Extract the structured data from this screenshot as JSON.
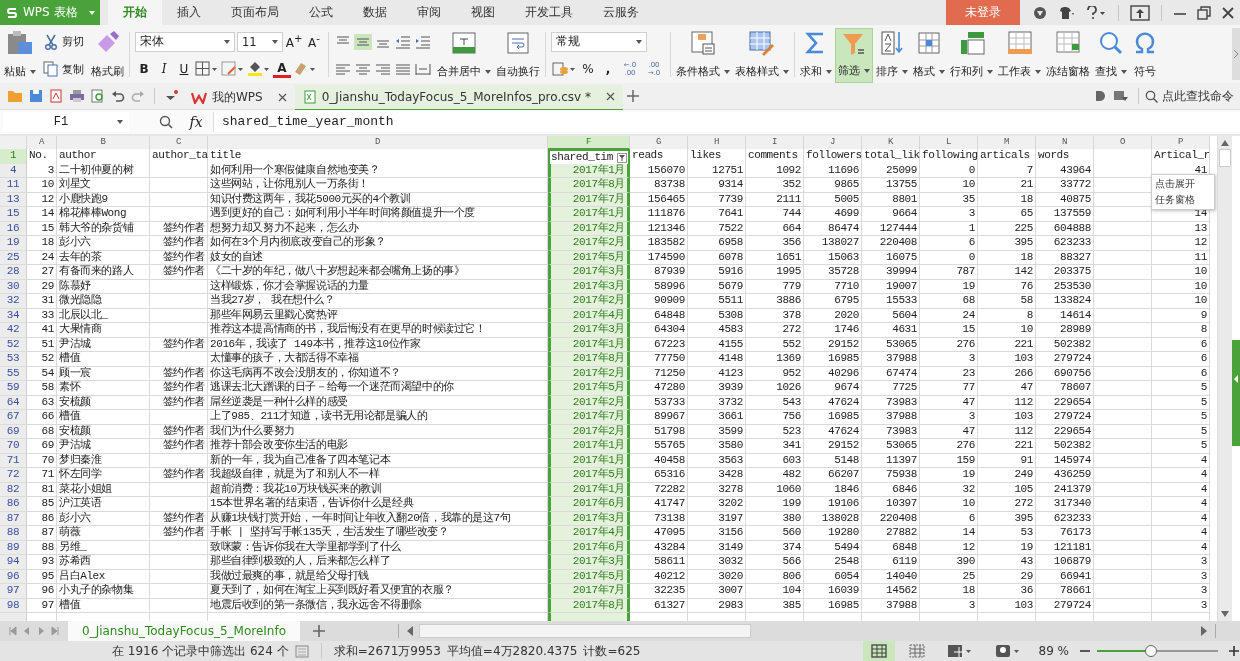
{
  "app_menu": {
    "label": "WPS 表格"
  },
  "tabs": [
    {
      "label": "开始",
      "selected": true
    },
    {
      "label": "插入",
      "selected": false
    },
    {
      "label": "页面布局",
      "selected": false
    },
    {
      "label": "公式",
      "selected": false
    },
    {
      "label": "数据",
      "selected": false
    },
    {
      "label": "审阅",
      "selected": false
    },
    {
      "label": "视图",
      "selected": false
    },
    {
      "label": "开发工具",
      "selected": false
    },
    {
      "label": "云服务",
      "selected": false
    }
  ],
  "login": {
    "label": "未登录"
  },
  "ribbon": {
    "paste": "粘贴",
    "cut": "剪切",
    "copy": "复制",
    "painter": "格式刷",
    "font": "宋体",
    "font_size": "11",
    "grow_font": "A$^{+}$",
    "shrink_font": "A$^{-}$",
    "bold": "B",
    "italic": "I",
    "underline": "U",
    "font_color": "A",
    "merge": "合并居中",
    "wrap": "自动换行",
    "number_format": "常规",
    "percent": "%",
    "comma": ",",
    "increase_decimal": [
      "←.0",
      ".00"
    ],
    "decrease_decimal": [
      ".00",
      "→.0"
    ],
    "conditional": "条件格式",
    "table_style": "表格样式",
    "sum": "求和",
    "filter": {
      "label": "筛选",
      "on": true
    },
    "sort": "排序",
    "format": "格式",
    "rows_cols": "行和列",
    "sheet": "工作表",
    "freeze": "冻结窗格",
    "find": "查找",
    "symbol": "符号"
  },
  "doc_tabs": [
    {
      "label": "我的WPS",
      "selected": false
    },
    {
      "label": "0_Jianshu_TodayFocus_5_MoreInfos_pro.csv *",
      "selected": true
    }
  ],
  "command_search": {
    "placeholder": "点此查找命令"
  },
  "name_box": "F1",
  "fx": "fx",
  "formula": "shared_time_year_month",
  "columns": [
    {
      "letter": "A",
      "selected": false
    },
    {
      "letter": "B",
      "selected": false
    },
    {
      "letter": "C",
      "selected": false
    },
    {
      "letter": "D",
      "selected": false
    },
    {
      "letter": "F",
      "selected": true
    },
    {
      "letter": "G",
      "selected": false
    },
    {
      "letter": "H",
      "selected": false
    },
    {
      "letter": "I",
      "selected": false
    },
    {
      "letter": "J",
      "selected": false
    },
    {
      "letter": "K",
      "selected": false
    },
    {
      "letter": "L",
      "selected": false
    },
    {
      "letter": "M",
      "selected": false
    },
    {
      "letter": "N",
      "selected": false
    },
    {
      "letter": "O",
      "selected": false
    },
    {
      "letter": "P",
      "selected": false
    }
  ],
  "header_row": {
    "n": "1",
    "no": "No.",
    "author": "author",
    "tag": "author_ta",
    "title": "title",
    "month": "shared_tim",
    "reads": "reads",
    "likes": "likes",
    "comments": "comments",
    "followers": "followers",
    "total_likes": "total_lik",
    "following": "following",
    "articals": "articals",
    "words": "words",
    "col_p": "Artical_r"
  },
  "rows": [
    {
      "n": "4",
      "no": "3",
      "author": "二十初仲夏的树",
      "title": "如何利用一个寒假健康自然地变美？",
      "month": "2017年1月",
      "reads": "156070",
      "likes": "12751",
      "comments": "1092",
      "followers": "11696",
      "total_likes": "25099",
      "following": "0",
      "articals": "7",
      "words": "43964",
      "col_p": "41"
    },
    {
      "n": "11",
      "no": "10",
      "author": "刘星文",
      "title": "这些网站，让你甩别人一万条街！",
      "month": "2017年8月",
      "reads": "83738",
      "likes": "9314",
      "comments": "352",
      "followers": "9865",
      "total_likes": "13755",
      "following": "10",
      "articals": "21",
      "words": "33772"
    },
    {
      "n": "13",
      "no": "12",
      "author": "小鹿快跑9",
      "title": "知识付费这两年，我花5000元买的4个教训",
      "month": "2017年7月",
      "reads": "156465",
      "likes": "7739",
      "comments": "2111",
      "followers": "5005",
      "total_likes": "8801",
      "following": "35",
      "articals": "18",
      "words": "40875"
    },
    {
      "n": "15",
      "no": "14",
      "author": "棉花棒棒Wong",
      "title": "遇到更好的自己：如何利用小半年时间将颜值提升一个度",
      "month": "2017年1月",
      "reads": "111876",
      "likes": "7641",
      "comments": "744",
      "followers": "4699",
      "total_likes": "9664",
      "following": "3",
      "articals": "65",
      "words": "137559",
      "col_p": "14"
    },
    {
      "n": "16",
      "no": "15",
      "author": "韩大爷的杂货铺",
      "tag": "签约作者",
      "title": "想努力却又努力不起来，怎么办",
      "month": "2017年2月",
      "reads": "121346",
      "likes": "7522",
      "comments": "664",
      "followers": "86474",
      "total_likes": "127444",
      "following": "1",
      "articals": "225",
      "words": "604888",
      "col_p": "13"
    },
    {
      "n": "19",
      "no": "18",
      "author": "彭小六",
      "tag": "签约作者",
      "title": "如何在3个月内彻底改变自己的形象？",
      "month": "2017年2月",
      "reads": "183582",
      "likes": "6958",
      "comments": "356",
      "followers": "138027",
      "total_likes": "220408",
      "following": "6",
      "articals": "395",
      "words": "623233",
      "col_p": "12"
    },
    {
      "n": "25",
      "no": "24",
      "author": "去年的茶",
      "tag": "签约作者",
      "title": "妓女的自述",
      "month": "2017年5月",
      "reads": "174590",
      "likes": "6078",
      "comments": "1651",
      "followers": "15063",
      "total_likes": "16075",
      "following": "0",
      "articals": "18",
      "words": "88327",
      "col_p": "11"
    },
    {
      "n": "28",
      "no": "27",
      "author": "有备而来的路人",
      "tag": "签约作者",
      "title": "《二十岁的年纪，做八十岁想起来都会嘴角上扬的事》",
      "month": "2017年3月",
      "reads": "87939",
      "likes": "5916",
      "comments": "1995",
      "followers": "35728",
      "total_likes": "39994",
      "following": "787",
      "articals": "142",
      "words": "203375",
      "col_p": "10"
    },
    {
      "n": "30",
      "no": "29",
      "author": "陈慕妤",
      "title": "这样锻炼，你才会掌握说话的力量",
      "month": "2017年3月",
      "reads": "58996",
      "likes": "5679",
      "comments": "779",
      "followers": "7710",
      "total_likes": "19007",
      "following": "19",
      "articals": "76",
      "words": "253530",
      "col_p": "10"
    },
    {
      "n": "32",
      "no": "31",
      "author": "微光隐隐",
      "title": "当我27岁， 我在想什么？",
      "month": "2017年2月",
      "reads": "90909",
      "likes": "5511",
      "comments": "3886",
      "followers": "6795",
      "total_likes": "15533",
      "following": "68",
      "articals": "58",
      "words": "133824",
      "col_p": "10"
    },
    {
      "n": "34",
      "no": "33",
      "author": "北辰以北_",
      "title": "那些年网易云里戳心窝热评",
      "month": "2017年4月",
      "reads": "64848",
      "likes": "5308",
      "comments": "378",
      "followers": "2020",
      "total_likes": "5604",
      "following": "24",
      "articals": "8",
      "words": "14614",
      "col_p": "9"
    },
    {
      "n": "42",
      "no": "41",
      "author": "大果情商",
      "title": "推荐这本提高情商的书，我后悔没有在更早的时候读过它！",
      "month": "2017年3月",
      "reads": "64304",
      "likes": "4583",
      "comments": "272",
      "followers": "1746",
      "total_likes": "4631",
      "following": "15",
      "articals": "10",
      "words": "28989",
      "col_p": "8"
    },
    {
      "n": "52",
      "no": "51",
      "author": "尹沽城",
      "tag": "签约作者",
      "title": "2016年，我读了 149本书，推荐这10位作家",
      "month": "2017年1月",
      "reads": "67223",
      "likes": "4155",
      "comments": "552",
      "followers": "29152",
      "total_likes": "53065",
      "following": "276",
      "articals": "221",
      "words": "502382",
      "col_p": "6"
    },
    {
      "n": "53",
      "no": "52",
      "author": "槽值",
      "title": "太懂事的孩子，大都活得不幸福",
      "month": "2017年8月",
      "reads": "77750",
      "likes": "4148",
      "comments": "1369",
      "followers": "16985",
      "total_likes": "37988",
      "following": "3",
      "articals": "103",
      "words": "279724",
      "col_p": "6"
    },
    {
      "n": "55",
      "no": "54",
      "author": "顾一宸",
      "tag": "签约作者",
      "title": "你这毛病再不改会没朋友的，你知道不？",
      "month": "2017年2月",
      "reads": "71250",
      "likes": "4123",
      "comments": "952",
      "followers": "40296",
      "total_likes": "67474",
      "following": "23",
      "articals": "266",
      "words": "690756",
      "col_p": "6"
    },
    {
      "n": "59",
      "no": "58",
      "author": "素怀",
      "tag": "签约作者",
      "title": "逃课去北大蹭课的日子－给每一个迷茫而渴望中的你",
      "month": "2017年5月",
      "reads": "47280",
      "likes": "3939",
      "comments": "1026",
      "followers": "9674",
      "total_likes": "7725",
      "following": "77",
      "articals": "47",
      "words": "78607",
      "col_p": "5"
    },
    {
      "n": "64",
      "no": "63",
      "author": "安梳颜",
      "tag": "签约作者",
      "title": "屌丝逆袭是一种什么样的感受",
      "month": "2017年2月",
      "reads": "53733",
      "likes": "3732",
      "comments": "543",
      "followers": "47624",
      "total_likes": "73983",
      "following": "47",
      "articals": "112",
      "words": "229654",
      "col_p": "5"
    },
    {
      "n": "67",
      "no": "66",
      "author": "槽值",
      "title": "上了985、211才知道，读书无用论都是骗人的",
      "month": "2017年7月",
      "reads": "89967",
      "likes": "3661",
      "comments": "756",
      "followers": "16985",
      "total_likes": "37988",
      "following": "3",
      "articals": "103",
      "words": "279724",
      "col_p": "5"
    },
    {
      "n": "69",
      "no": "68",
      "author": "安梳颜",
      "tag": "签约作者",
      "title": "我们为什么要努力",
      "month": "2017年2月",
      "reads": "51798",
      "likes": "3599",
      "comments": "523",
      "followers": "47624",
      "total_likes": "73983",
      "following": "47",
      "articals": "112",
      "words": "229654",
      "col_p": "5"
    },
    {
      "n": "70",
      "no": "69",
      "author": "尹沽城",
      "tag": "签约作者",
      "title": "推荐十部会改变你生活的电影",
      "month": "2017年1月",
      "reads": "55765",
      "likes": "3580",
      "comments": "341",
      "followers": "29152",
      "total_likes": "53065",
      "following": "276",
      "articals": "221",
      "words": "502382",
      "col_p": "5"
    },
    {
      "n": "71",
      "no": "70",
      "author": "梦归秦淮",
      "title": "新的一年，我为自己准备了四本笔记本",
      "month": "2017年1月",
      "reads": "40458",
      "likes": "3563",
      "comments": "603",
      "followers": "5148",
      "total_likes": "11397",
      "following": "159",
      "articals": "91",
      "words": "145974",
      "col_p": "4"
    },
    {
      "n": "72",
      "no": "71",
      "author": "怀左同学",
      "tag": "签约作者",
      "title": "我超级自律，就是为了和别人不一样",
      "month": "2017年5月",
      "reads": "65316",
      "likes": "3428",
      "comments": "482",
      "followers": "66207",
      "total_likes": "75938",
      "following": "19",
      "articals": "249",
      "words": "436259",
      "col_p": "4"
    },
    {
      "n": "82",
      "no": "81",
      "author": "菜花小姐姐",
      "title": "超前消费：我花10万块钱买来的教训",
      "month": "2017年1月",
      "reads": "72282",
      "likes": "3278",
      "comments": "1060",
      "followers": "1846",
      "total_likes": "6846",
      "following": "32",
      "articals": "105",
      "words": "241379",
      "col_p": "4"
    },
    {
      "n": "86",
      "no": "85",
      "author": "沪江英语",
      "title": "15本世界名著的结束语，告诉你什么是经典",
      "month": "2017年6月",
      "reads": "41747",
      "likes": "3202",
      "comments": "199",
      "followers": "19106",
      "total_likes": "10397",
      "following": "10",
      "articals": "272",
      "words": "317340",
      "col_p": "4"
    },
    {
      "n": "87",
      "no": "86",
      "author": "彭小六",
      "tag": "签约作者",
      "title": "从赚1块钱打赏开始，一年时间让年收入翻20倍，我靠的是这7句",
      "month": "2017年3月",
      "reads": "73138",
      "likes": "3197",
      "comments": "380",
      "followers": "138028",
      "total_likes": "220408",
      "following": "6",
      "articals": "395",
      "words": "623233",
      "col_p": "4"
    },
    {
      "n": "88",
      "no": "87",
      "author": "萌薇",
      "tag": "签约作者",
      "title": "手帐 | 坚持写手帐135天，生活发生了哪些改变？",
      "month": "2017年4月",
      "reads": "47095",
      "likes": "3156",
      "comments": "560",
      "followers": "19280",
      "total_likes": "27882",
      "following": "14",
      "articals": "53",
      "words": "76173",
      "col_p": "4"
    },
    {
      "n": "89",
      "no": "88",
      "author": "另维_",
      "title": "致咪蒙：告诉你我在大学里都学到了什么",
      "month": "2017年6月",
      "reads": "43284",
      "likes": "3149",
      "comments": "374",
      "followers": "5494",
      "total_likes": "6848",
      "following": "12",
      "articals": "19",
      "words": "121181",
      "col_p": "4"
    },
    {
      "n": "94",
      "no": "93",
      "author": "苏希西",
      "title": "那些自律到极致的人，后来都怎么样了",
      "month": "2017年3月",
      "reads": "58611",
      "likes": "3032",
      "comments": "566",
      "followers": "2548",
      "total_likes": "6119",
      "following": "390",
      "articals": "43",
      "words": "106879",
      "col_p": "3"
    },
    {
      "n": "96",
      "no": "95",
      "author": "吕白Alex",
      "title": "我做过最爽的事，就是给父母打钱",
      "month": "2017年5月",
      "reads": "40212",
      "likes": "3020",
      "comments": "806",
      "followers": "6054",
      "total_likes": "14040",
      "following": "25",
      "articals": "29",
      "words": "66941",
      "col_p": "3"
    },
    {
      "n": "97",
      "no": "96",
      "author": "小丸子的杂物集",
      "title": "夏天到了，如何在淘宝上买到既好看又便宜的衣服？",
      "month": "2017年7月",
      "reads": "32235",
      "likes": "3007",
      "comments": "104",
      "followers": "16039",
      "total_likes": "14562",
      "following": "18",
      "articals": "36",
      "words": "78661",
      "col_p": "3"
    },
    {
      "n": "98",
      "no": "97",
      "author": "槽值",
      "title": "地震后收到的第一条微信，我永远舍不得删除",
      "month": "2017年8月",
      "reads": "61327",
      "likes": "2983",
      "comments": "385",
      "followers": "16985",
      "total_likes": "37988",
      "following": "3",
      "articals": "103",
      "words": "279724",
      "col_p": "3"
    }
  ],
  "tooltip": [
    "点击展开",
    "任务窗格"
  ],
  "sheet_tabs": [
    {
      "label": "0_Jianshu_TodayFocus_5_MoreInfo",
      "selected": true
    }
  ],
  "status": {
    "filter_info": "在 1916 个记录中筛选出 624 个",
    "sum": "求和=2671万9953",
    "average": "平均值=4万2820.4375",
    "count": "计数=625",
    "zoom": "89 %",
    "zoom_slider": {
      "level": 0.45
    }
  }
}
